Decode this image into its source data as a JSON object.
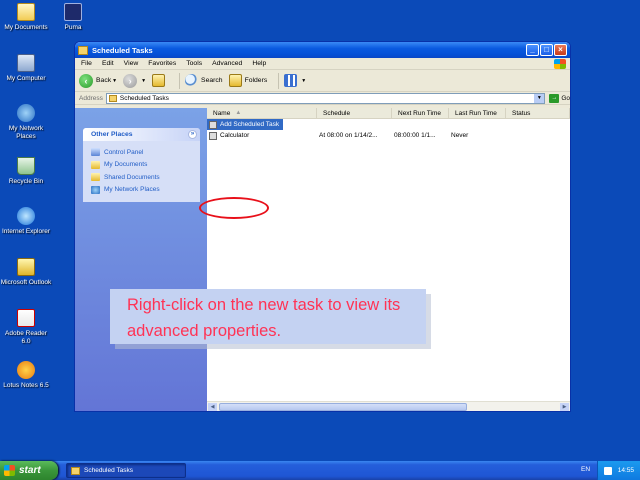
{
  "desktop": {
    "icons": [
      {
        "label": "My Documents"
      },
      {
        "label": "Puma"
      },
      {
        "label": "My Computer"
      },
      {
        "label": "My Network Places"
      },
      {
        "label": "Recycle Bin"
      },
      {
        "label": "Internet Explorer"
      },
      {
        "label": "Microsoft Outlook"
      },
      {
        "label": "Adobe Reader 6.0"
      },
      {
        "label": "Lotus Notes 6.5"
      }
    ]
  },
  "window": {
    "title": "Scheduled Tasks",
    "menu": [
      "File",
      "Edit",
      "View",
      "Favorites",
      "Tools",
      "Advanced",
      "Help"
    ],
    "toolbar": {
      "back": "Back",
      "search": "Search",
      "folders": "Folders"
    },
    "address": {
      "label": "Address",
      "value": "Scheduled Tasks",
      "go": "Go"
    },
    "other_places": {
      "title": "Other Places",
      "links": [
        "Control Panel",
        "My Documents",
        "Shared Documents",
        "My Network Places"
      ]
    },
    "columns": [
      "Name",
      "Schedule",
      "Next Run Time",
      "Last Run Time",
      "Status"
    ],
    "rows": [
      {
        "name": "Add Scheduled Task",
        "schedule": "",
        "next": "",
        "last": "",
        "status": ""
      },
      {
        "name": "Calculator",
        "schedule": "At 08:00 on 1/14/2...",
        "next": "08:00:00  1/1...",
        "last": "Never",
        "status": ""
      }
    ]
  },
  "callout": {
    "text": "Right-click on the new task to view its advanced properties."
  },
  "taskbar": {
    "start": "start",
    "item": "Scheduled Tasks",
    "lang": "EN",
    "clock": "14:55"
  },
  "colors": {
    "desktop": "#0b4ab8",
    "highlight_ring": "#e8101a",
    "callout_text": "#ff3355",
    "selection": "#316ac5"
  }
}
